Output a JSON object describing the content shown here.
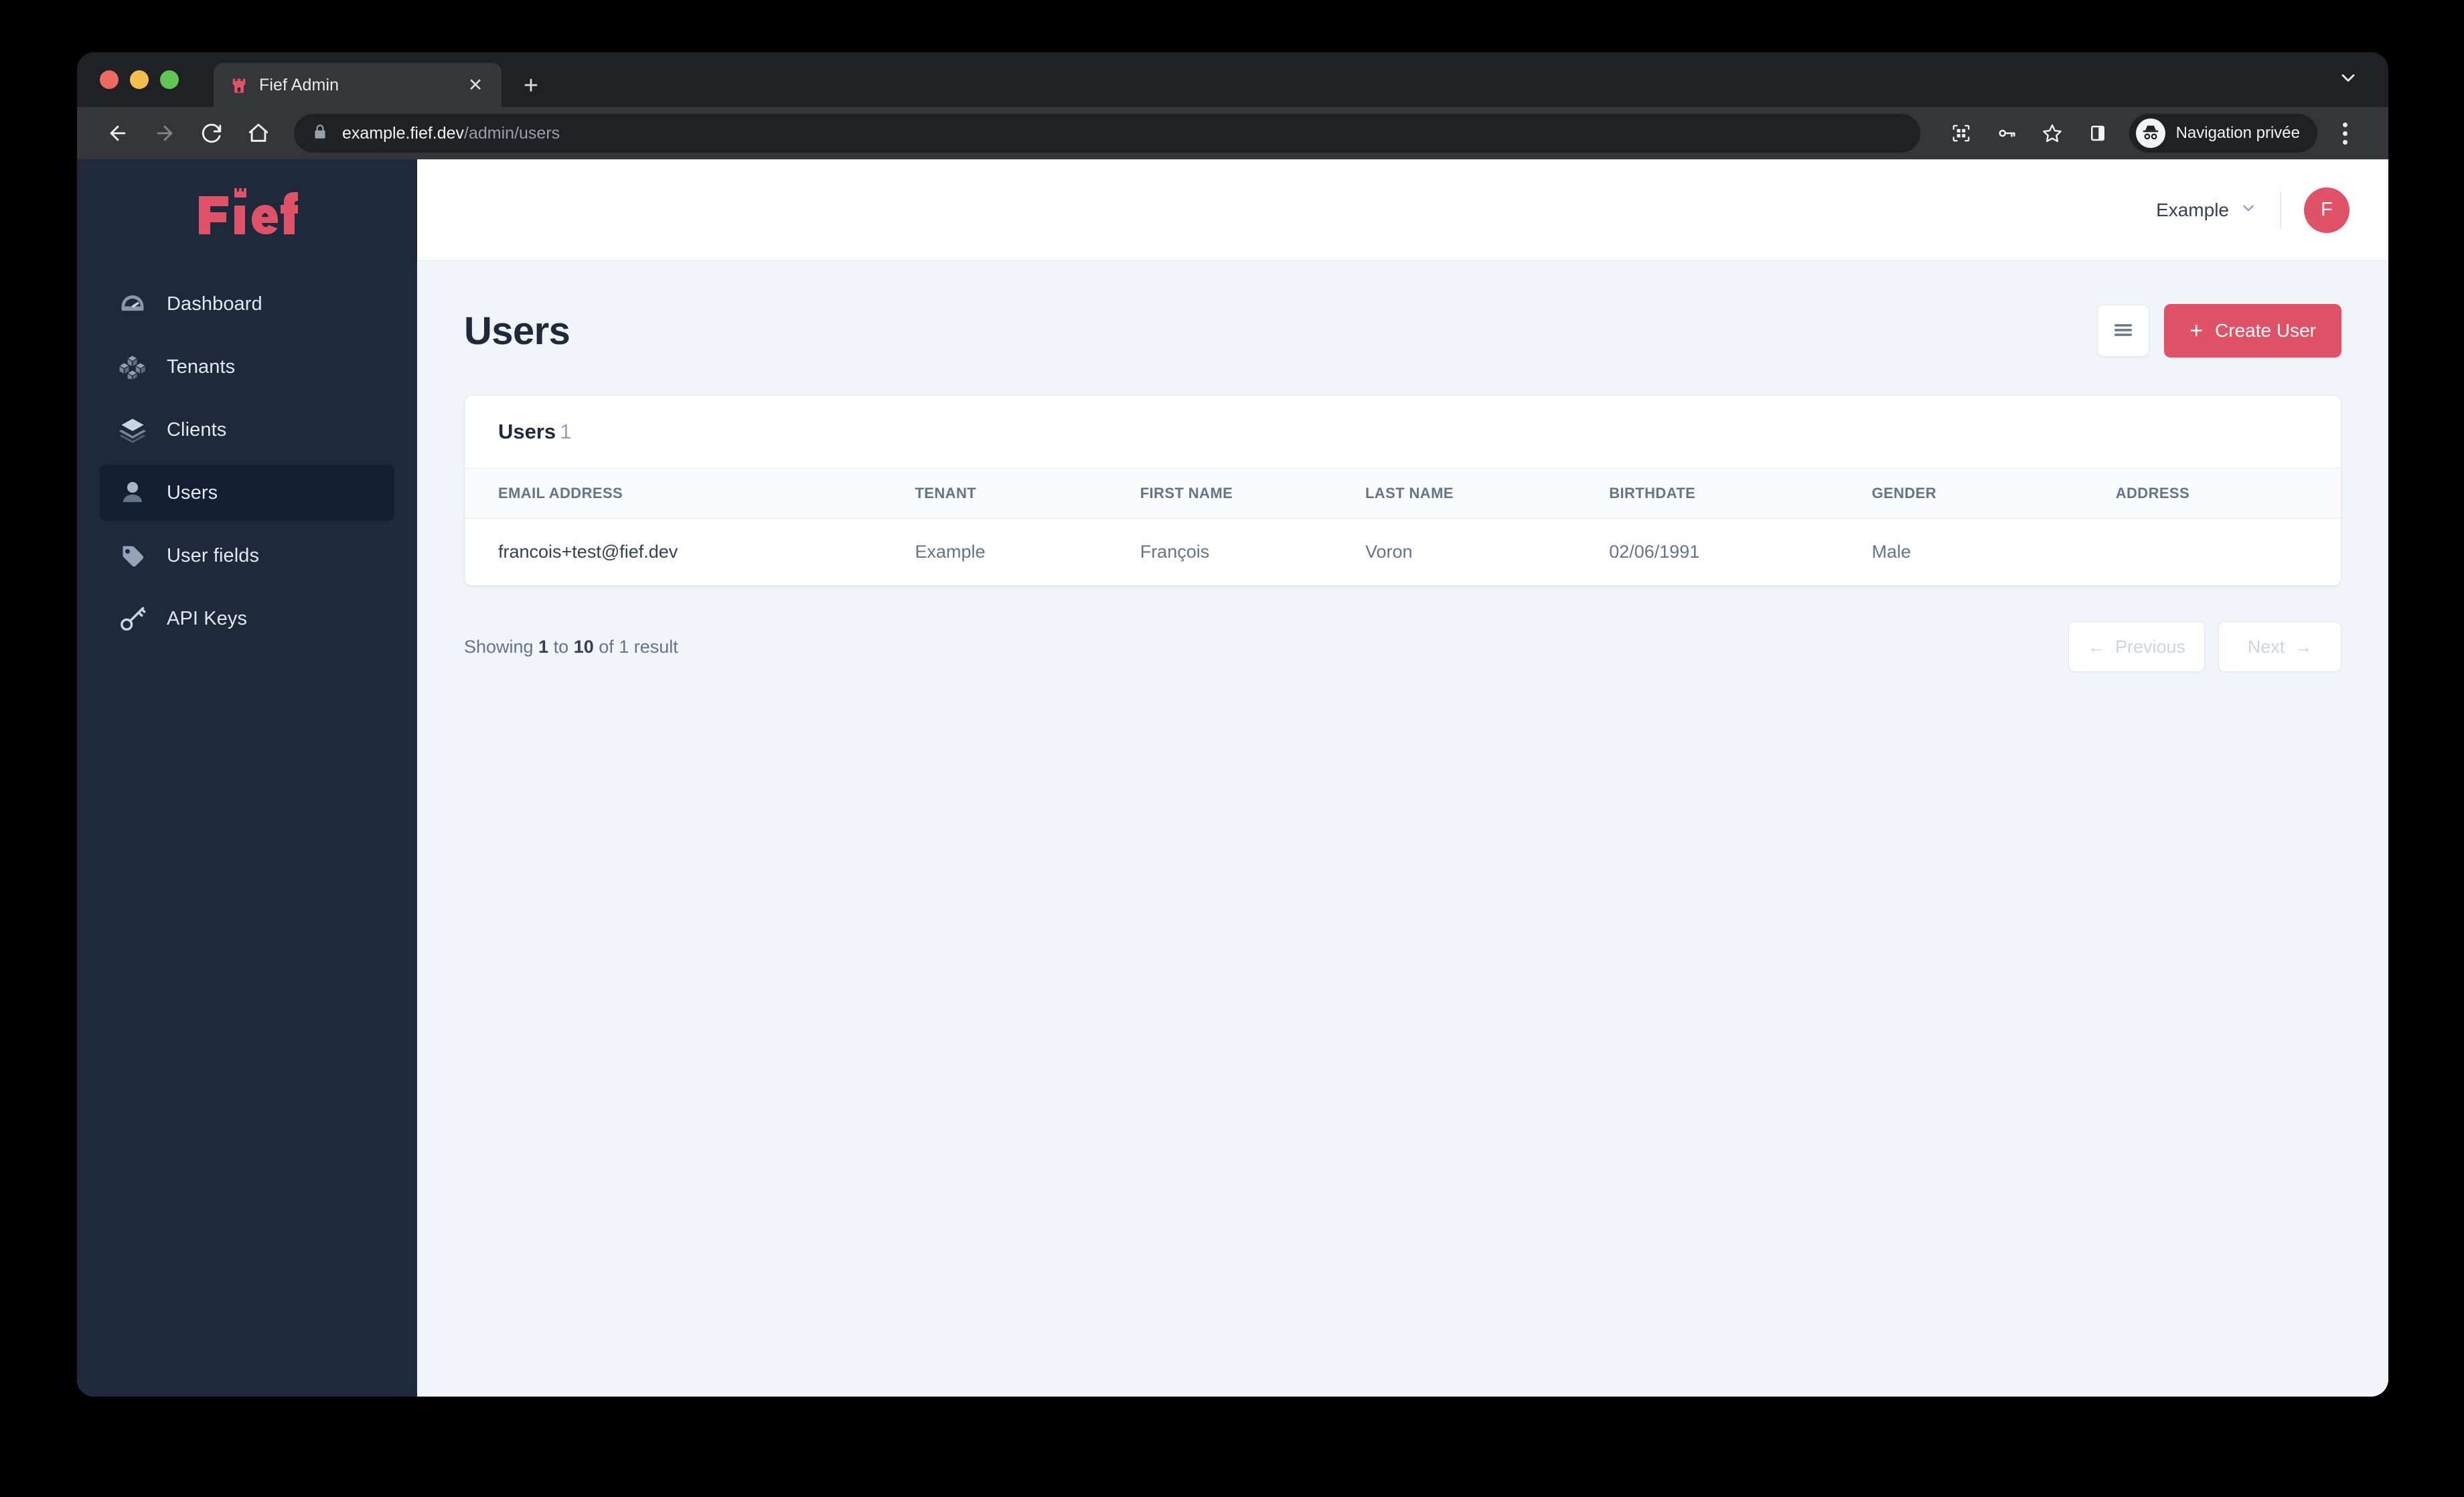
{
  "browser": {
    "tab": {
      "title": "Fief Admin",
      "favicon_icon": "fief-castle-icon",
      "close_icon": "close-icon"
    },
    "new_tab_icon": "plus-icon",
    "tabstrip_chevron_icon": "chevron-down-icon",
    "nav": {
      "back_icon": "arrow-left-icon",
      "forward_icon": "arrow-right-icon",
      "reload_icon": "reload-icon",
      "home_icon": "home-icon"
    },
    "omnibox": {
      "lock_icon": "lock-icon",
      "url_host": "example.fief.dev",
      "url_path": "/admin/users"
    },
    "toolbar_right": {
      "qr_icon": "qr-code-icon",
      "password_icon": "key-icon",
      "bookmark_icon": "star-icon",
      "side_panel_icon": "side-panel-icon",
      "incognito_icon": "incognito-avatar-icon",
      "incognito_label": "Navigation privée",
      "menu_icon": "kebab-menu-icon"
    }
  },
  "sidebar": {
    "logo_text": "Fief",
    "items": [
      {
        "label": "Dashboard",
        "icon": "speedometer-icon",
        "active": false
      },
      {
        "label": "Tenants",
        "icon": "cubes-icon",
        "active": false
      },
      {
        "label": "Clients",
        "icon": "layers-icon",
        "active": false
      },
      {
        "label": "Users",
        "icon": "user-icon",
        "active": true
      },
      {
        "label": "User fields",
        "icon": "tag-icon",
        "active": false
      },
      {
        "label": "API Keys",
        "icon": "key-icon",
        "active": false
      }
    ]
  },
  "topbar": {
    "tenant_name": "Example",
    "tenant_chevron_icon": "chevron-down-icon",
    "avatar_initial": "F"
  },
  "page": {
    "title": "Users",
    "list_view_icon": "list-view-icon",
    "create_button_label": "Create User",
    "create_button_plus": "+"
  },
  "card": {
    "title": "Users",
    "count": "1"
  },
  "table": {
    "columns": [
      "EMAIL ADDRESS",
      "TENANT",
      "FIRST NAME",
      "LAST NAME",
      "BIRTHDATE",
      "GENDER",
      "ADDRESS"
    ],
    "rows": [
      {
        "email": "francois+test@fief.dev",
        "tenant": "Example",
        "first_name": "François",
        "last_name": "Voron",
        "birthdate": "02/06/1991",
        "gender": "Male",
        "address": ""
      }
    ]
  },
  "pagination": {
    "showing_prefix": "Showing",
    "from": "1",
    "mid": "to",
    "to": "10",
    "suffix": "of 1 result",
    "previous_label": "Previous",
    "next_label": "Next",
    "previous_arrow": "←",
    "next_arrow": "→"
  },
  "colors": {
    "brand": "#e05267",
    "sidebar_bg": "#1e293b",
    "sidebar_active_bg": "#151f33",
    "page_bg": "#f1f5f9",
    "text_dark": "#1e293b"
  }
}
